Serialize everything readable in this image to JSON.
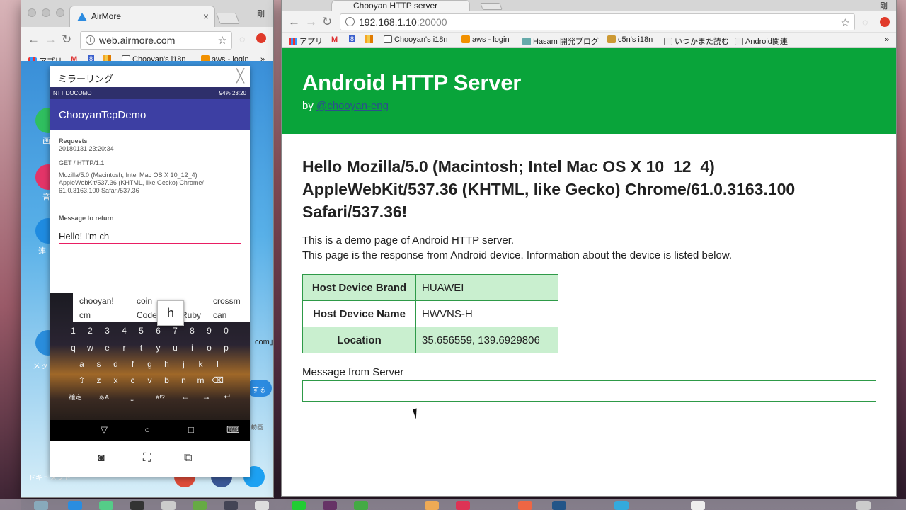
{
  "left_window": {
    "tab_title": "AirMore",
    "url": "web.airmore.com",
    "user_initial": "剛",
    "bookmarks": [
      "アプリ",
      "M",
      "8",
      "Chooyan's i18n",
      "aws - login",
      "»"
    ],
    "side_labels": [
      "画",
      "音",
      "連",
      "メッ",
      "ドキュメント"
    ],
    "side_snippets": [
      "com」",
      "する",
      "動画",
      "FL"
    ]
  },
  "mirroring": {
    "title": "ミラーリング",
    "status_left": "NTT DOCOMO",
    "status_right": "94% 23:20",
    "app_title": "ChooyanTcpDemo",
    "requests_label": "Requests",
    "request_time": "20180131 23:20:34",
    "request_line": "GET / HTTP/1.1",
    "user_agent_1": "Mozilla/5.0 (Macintosh; Intel Mac OS X 10_12_4)",
    "user_agent_2": "AppleWebKit/537.36 (KHTML, like Gecko) Chrome/",
    "user_agent_3": "61.0.3163.100 Safari/537.36",
    "message_label": "Message to return",
    "message_value": "Hello! I'm ch",
    "suggestions": [
      "chooyan!",
      "coin",
      "crossm",
      "cm",
      "Code",
      "Ruby",
      "can"
    ],
    "key_popup": "h",
    "number_row": [
      "1",
      "2",
      "3",
      "4",
      "5",
      "6",
      "7",
      "8",
      "9",
      "0"
    ],
    "row_q": [
      "q",
      "w",
      "e",
      "r",
      "t",
      "y",
      "u",
      "i",
      "o",
      "p"
    ],
    "row_a": [
      "a",
      "s",
      "d",
      "f",
      "g",
      "h",
      "j",
      "k",
      "l"
    ],
    "row_z": [
      "⇧",
      "z",
      "x",
      "c",
      "v",
      "b",
      "n",
      "m",
      "⌫"
    ],
    "row_fn": [
      "確定",
      "ぁA",
      "⎵",
      "#!?",
      "←",
      "→",
      "↵"
    ],
    "nav_keys": [
      "▽",
      "○",
      "□",
      "⌨"
    ],
    "tool_icons": [
      "camera-icon",
      "screenshot-icon",
      "window-icon"
    ]
  },
  "right_window": {
    "tab_title": "Chooyan HTTP server",
    "user_initial": "剛",
    "url_host": "192.168.1.10",
    "url_port": ":20000",
    "bookmarks": [
      "アプリ",
      "M",
      "8",
      "Chooyan's i18n",
      "aws - login",
      "Hasam 開発ブログ",
      "c5n's i18n",
      "いつかまた読む",
      "Android関連",
      "»"
    ]
  },
  "page": {
    "title": "Android HTTP Server",
    "by_prefix": "by ",
    "by_link": "@chooyan-eng",
    "greeting": "Hello Mozilla/5.0 (Macintosh; Intel Mac OS X 10_12_4) AppleWebKit/537.36 (KHTML, like Gecko) Chrome/61.0.3163.100 Safari/537.36!",
    "intro_1": "This is a demo page of Android HTTP server.",
    "intro_2": "This page is the response from Android device. Information about the device is listed below.",
    "table": [
      {
        "key": "Host Device Brand",
        "value": "HUAWEI"
      },
      {
        "key": "Host Device Name",
        "value": "HWVNS-H"
      },
      {
        "key": "Location",
        "value": "35.656559, 139.6929806"
      }
    ],
    "message_label": "Message from Server",
    "message_value": ""
  },
  "colors": {
    "header_green": "#09a43a",
    "table_green": "#c9efcf",
    "app_bar": "#3d3fa3",
    "accent_pink": "#e91e63"
  }
}
